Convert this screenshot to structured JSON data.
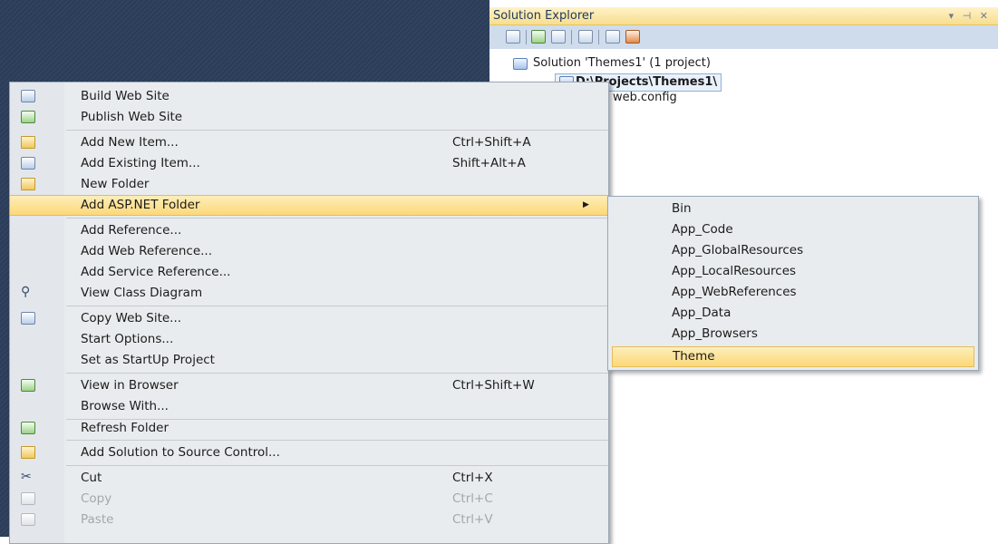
{
  "solution_explorer": {
    "title": "Solution Explorer",
    "pin_glyphs": "▾ ⊣ ✕",
    "solution_label": "Solution 'Themes1' (1 project)",
    "project_label": "D:\\Projects\\Themes1\\",
    "file_label": "web.config"
  },
  "context_menu": {
    "items": [
      {
        "label": "Build Web Site",
        "shortcut": "",
        "icon": "build-icon"
      },
      {
        "label": "Publish Web Site",
        "shortcut": "",
        "icon": "publish-icon"
      },
      {
        "label": "Add New Item...",
        "shortcut": "Ctrl+Shift+A",
        "icon": "add-new-item-icon"
      },
      {
        "label": "Add Existing Item...",
        "shortcut": "Shift+Alt+A",
        "icon": "add-existing-item-icon"
      },
      {
        "label": "New Folder",
        "shortcut": "",
        "icon": "folder-icon"
      },
      {
        "label": "Add ASP.NET Folder",
        "shortcut": "",
        "icon": "",
        "submenu": true,
        "highlighted": true
      },
      {
        "label": "Add Reference...",
        "shortcut": ""
      },
      {
        "label": "Add Web Reference...",
        "shortcut": ""
      },
      {
        "label": "Add Service Reference...",
        "shortcut": ""
      },
      {
        "label": "View Class Diagram",
        "shortcut": "",
        "icon": "class-diagram-icon"
      },
      {
        "label": "Copy Web Site...",
        "shortcut": "",
        "icon": "copy-web-site-icon"
      },
      {
        "label": "Start Options...",
        "shortcut": ""
      },
      {
        "label": "Set as StartUp Project",
        "shortcut": ""
      },
      {
        "label": "View in Browser",
        "shortcut": "Ctrl+Shift+W",
        "icon": "view-in-browser-icon"
      },
      {
        "label": "Browse With...",
        "shortcut": ""
      },
      {
        "label": "Refresh Folder",
        "shortcut": "",
        "icon": "refresh-icon"
      },
      {
        "label": "Add Solution to Source Control...",
        "shortcut": "",
        "icon": "source-control-icon"
      },
      {
        "label": "Cut",
        "shortcut": "Ctrl+X",
        "icon": "cut-icon"
      },
      {
        "label": "Copy",
        "shortcut": "Ctrl+C",
        "icon": "copy-icon",
        "disabled": true
      },
      {
        "label": "Paste",
        "shortcut": "Ctrl+V",
        "icon": "paste-icon",
        "disabled": true
      }
    ]
  },
  "submenu": {
    "items": [
      {
        "label": "Bin"
      },
      {
        "label": "App_Code"
      },
      {
        "label": "App_GlobalResources"
      },
      {
        "label": "App_LocalResources"
      },
      {
        "label": "App_WebReferences"
      },
      {
        "label": "App_Data"
      },
      {
        "label": "App_Browsers"
      },
      {
        "label": "Theme",
        "highlighted": true
      }
    ]
  },
  "colors": {
    "highlight": "#fbd97a",
    "menu_bg": "#e9ecee",
    "ide_bg": "#2b3c59"
  }
}
